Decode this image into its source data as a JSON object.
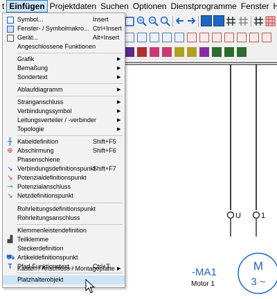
{
  "menubar": {
    "items": [
      "t",
      "Einfügen",
      "Projektdaten",
      "Suchen",
      "Optionen",
      "Dienstprogramme",
      "Fenster",
      "Hilfe"
    ],
    "active": "Einfügen"
  },
  "menu": {
    "items": [
      {
        "label": "Symbol...",
        "shortcut": "Insert",
        "icon": "symbol-icon"
      },
      {
        "label": "Fenster- / Symbolmakro...",
        "shortcut": "Ctrl+Insert",
        "icon": "window-macro-icon"
      },
      {
        "label": "Gerät...",
        "shortcut": "Alt+Insert",
        "icon": "device-icon"
      },
      {
        "label": "Angeschlossene Funktionen"
      },
      {
        "label": "Grafik",
        "submenu": true
      },
      {
        "label": "Bemaßung",
        "submenu": true
      },
      {
        "label": "Sondertext",
        "submenu": true
      },
      {
        "label": "Ablaufdiagramm",
        "submenu": true
      },
      {
        "label": "Stranganschluss",
        "submenu": true
      },
      {
        "label": "Verbindungssymbol",
        "submenu": true
      },
      {
        "label": "Leitungsverteiler / -verbinder",
        "submenu": true
      },
      {
        "label": "Topologie",
        "submenu": true
      },
      {
        "label": "Kabeldefinition",
        "shortcut": "Shift+F5",
        "icon": "cable-definition-icon"
      },
      {
        "label": "Abschirmung",
        "shortcut": "Shift+F6",
        "icon": "shielding-icon"
      },
      {
        "label": "Phasenschiene"
      },
      {
        "label": "Verbindungsdefinitionspunkt",
        "shortcut": "Shift+F7",
        "icon": "connection-definition-point-icon"
      },
      {
        "label": "Potenzialdefinitionspunkt",
        "icon": "potential-definition-point-icon"
      },
      {
        "label": "Potenzialanschluss",
        "icon": "potential-connection-icon"
      },
      {
        "label": "Netzdefinitionspunkt",
        "icon": "network-definition-point-icon"
      },
      {
        "label": "Rohrleitungsdefinitionspunkt"
      },
      {
        "label": "Rohrleitungsanschluss"
      },
      {
        "label": "Klemmenleistendefinition"
      },
      {
        "label": "Teilklemme",
        "icon": "partial-terminal-icon"
      },
      {
        "label": "Steckerdefinition"
      },
      {
        "label": "Artikeldefinitionspunkt",
        "icon": "part-definition-point-icon"
      },
      {
        "label": "Pfad-Funktionstext...",
        "shortcut": "Ctrl+T",
        "icon": "path-function-text-icon"
      },
      {
        "label": "Kasten / Anschluss / Montageplatte",
        "submenu": true
      },
      {
        "label": "Platzhalterobjekt",
        "highlighted": true
      }
    ]
  },
  "schematic": {
    "terminal_left": "U",
    "terminal_right": "1",
    "device_tag": "-MA1",
    "device_description": "Motor 1",
    "motor_letter": "M",
    "motor_phase": "3 ~"
  },
  "colors": {
    "accent_blue": "#1f66c2",
    "highlight": "#cce4f7",
    "menu_bg": "#f2f2f2"
  }
}
